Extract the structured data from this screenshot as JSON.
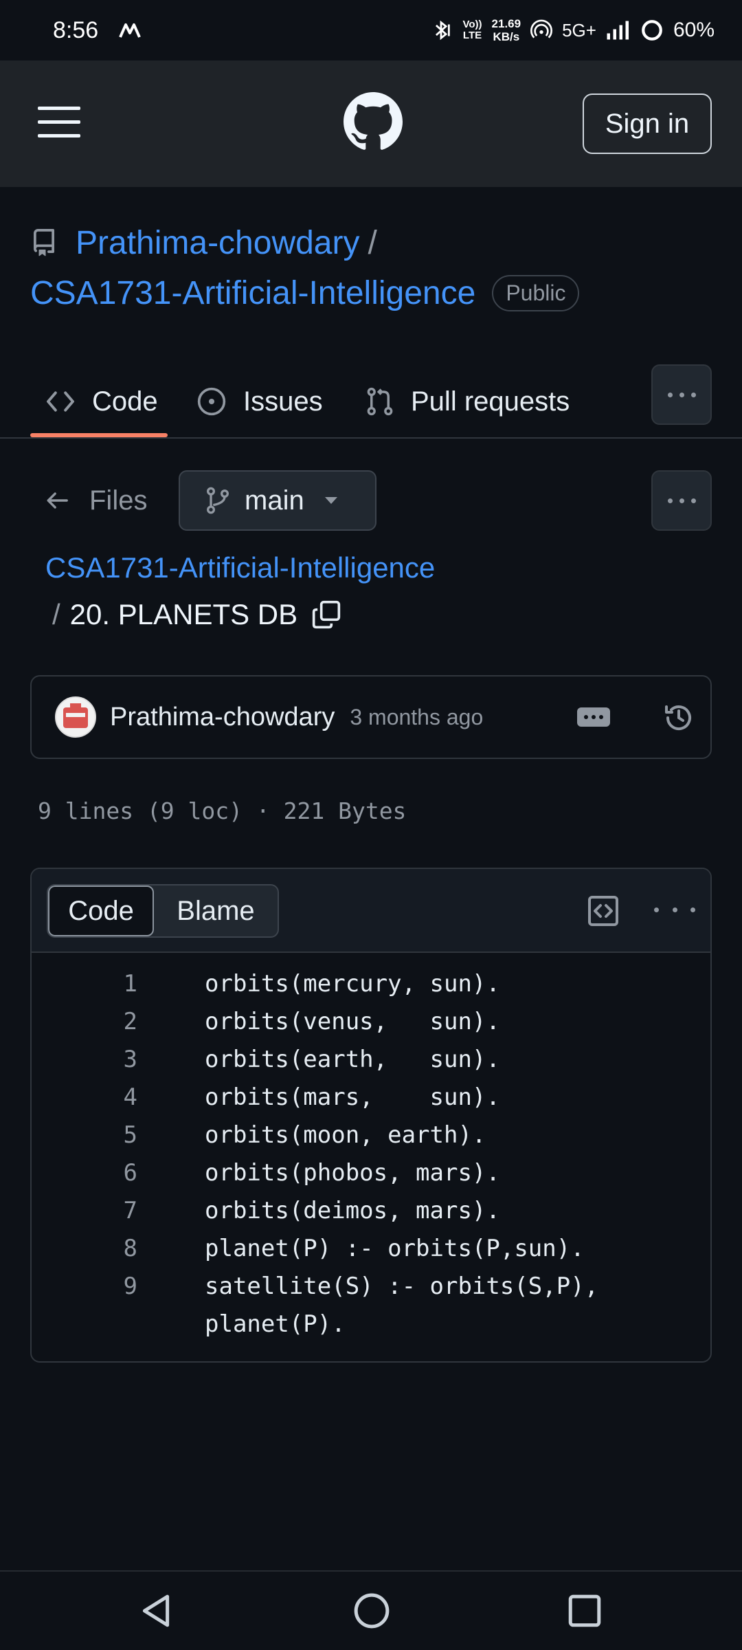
{
  "status_bar": {
    "time": "8:56",
    "volte_top": "Vo))",
    "volte_bottom": "LTE",
    "speed_value": "21.69",
    "speed_unit": "KB/s",
    "network": "5G+",
    "battery": "60%"
  },
  "header": {
    "sign_in_label": "Sign in"
  },
  "repo": {
    "owner": "Prathima-chowdary",
    "separator": "/",
    "name": "CSA1731-Artificial-Intelligence",
    "visibility": "Public"
  },
  "tabs": [
    {
      "label": "Code",
      "active": true
    },
    {
      "label": "Issues",
      "active": false
    },
    {
      "label": "Pull requests",
      "active": false
    }
  ],
  "file_nav": {
    "back_label": "Files",
    "branch": "main",
    "breadcrumb_repo": "CSA1731-Artificial-Intelligence",
    "breadcrumb_sep": "/",
    "file_name": "20. PLANETS DB"
  },
  "commit": {
    "author": "Prathima-chowdary",
    "time_ago": "3 months ago"
  },
  "file_meta": "9 lines (9 loc) · 221 Bytes",
  "code_view": {
    "code_tab": "Code",
    "blame_tab": "Blame",
    "lines": [
      {
        "n": "1",
        "text": "orbits(mercury, sun)."
      },
      {
        "n": "2",
        "text": "orbits(venus,   sun)."
      },
      {
        "n": "3",
        "text": "orbits(earth,   sun)."
      },
      {
        "n": "4",
        "text": "orbits(mars,    sun)."
      },
      {
        "n": "5",
        "text": "orbits(moon, earth)."
      },
      {
        "n": "6",
        "text": "orbits(phobos, mars)."
      },
      {
        "n": "7",
        "text": "orbits(deimos, mars)."
      },
      {
        "n": "8",
        "text": "planet(P) :- orbits(P,sun)."
      },
      {
        "n": "9",
        "text": "satellite(S) :- orbits(S,P),"
      }
    ],
    "line_9_wrap": "planet(P)."
  },
  "colors": {
    "background": "#0d1117",
    "header": "#1f2328",
    "link": "#4493f8",
    "active_tab": "#f78166",
    "muted": "#9198a1"
  }
}
